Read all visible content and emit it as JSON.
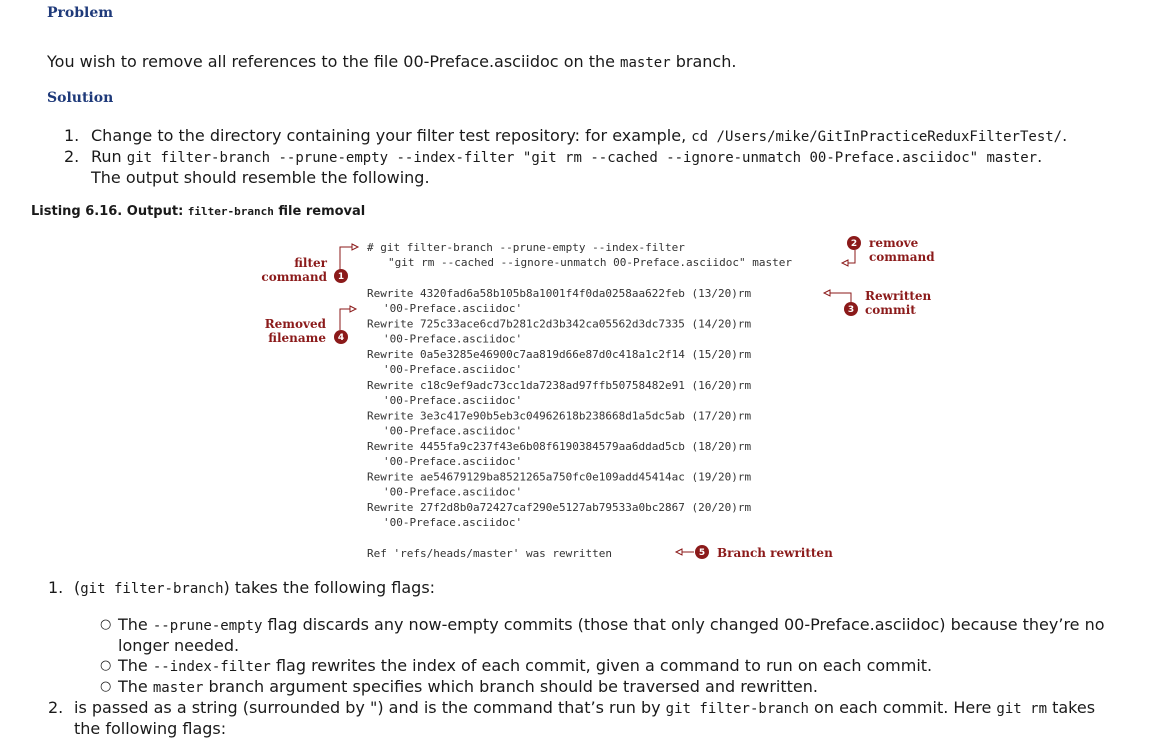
{
  "problem": {
    "heading": "Problem",
    "text_before": "You wish to remove all references to the file 00-Preface.asciidoc on the ",
    "branch_code": "master",
    "text_after": " branch."
  },
  "solution": {
    "heading": "Solution",
    "step1": {
      "num": "1.",
      "text": "Change to the directory containing your filter test repository: for example, ",
      "code": "cd /Users/mike/GitInPracticeReduxFilterTest/",
      "end": "."
    },
    "step2": {
      "num": "2.",
      "text": "Run ",
      "code": "git filter-branch --prune-empty --index-filter \"git rm --cached --ignore-unmatch 00-Preface.asciidoc\" master",
      "end": ".",
      "line2": "The output should resemble the following."
    }
  },
  "listing": {
    "caption_prefix": "Listing 6.16. Output: ",
    "caption_code": "filter-branch",
    "caption_suffix": " file removal",
    "command_line1": "# git filter-branch --prune-empty --index-filter",
    "command_line2": "\"git rm --cached --ignore-unmatch 00-Preface.asciidoc\" master",
    "rewrites": [
      {
        "line": "Rewrite 4320fad6a58b105b8a1001f4f0da0258aa622feb (13/20)rm",
        "file": "'00-Preface.asciidoc'"
      },
      {
        "line": "Rewrite 725c33ace6cd7b281c2d3b342ca05562d3dc7335 (14/20)rm",
        "file": "'00-Preface.asciidoc'"
      },
      {
        "line": "Rewrite 0a5e3285e46900c7aa819d66e87d0c418a1c2f14 (15/20)rm",
        "file": "'00-Preface.asciidoc'"
      },
      {
        "line": "Rewrite c18c9ef9adc73cc1da7238ad97ffb50758482e91 (16/20)rm",
        "file": "'00-Preface.asciidoc'"
      },
      {
        "line": "Rewrite 3e3c417e90b5eb3c04962618b238668d1a5dc5ab (17/20)rm",
        "file": "'00-Preface.asciidoc'"
      },
      {
        "line": "Rewrite 4455fa9c237f43e6b08f6190384579aa6ddad5cb (18/20)rm",
        "file": "'00-Preface.asciidoc'"
      },
      {
        "line": "Rewrite ae54679129ba8521265a750fc0e109add45414ac (19/20)rm",
        "file": "'00-Preface.asciidoc'"
      },
      {
        "line": "Rewrite 27f2d8b0a72427caf290e5127ab79533a0bc2867 (20/20)rm",
        "file": "'00-Preface.asciidoc'"
      }
    ],
    "ref_line": "Ref 'refs/heads/master' was rewritten",
    "annotations": {
      "filter_line1": "filter",
      "filter_line2": "command",
      "filter_num": "1",
      "remove_line1": "remove",
      "remove_line2": "command",
      "remove_num": "2",
      "rewritten_line1": "Rewritten",
      "rewritten_line2": "commit",
      "rewritten_num": "3",
      "removed_line1": "Removed",
      "removed_line2": "filename",
      "removed_num": "4",
      "branch_text": "Branch rewritten",
      "branch_num": "5"
    }
  },
  "notes": {
    "item1": {
      "num": "1.",
      "pre": "(",
      "code": "git filter-branch",
      "post": ") takes the following flags:"
    },
    "bullets": [
      {
        "pre": "The ",
        "code": "--prune-empty",
        "post": " flag discards any now-empty commits (those that only changed 00-Preface.asciidoc) because they’re no",
        "line2": "longer needed."
      },
      {
        "pre": "The ",
        "code": "--index-filter",
        "post": " flag rewrites the index of each commit, given a command to run on each commit."
      },
      {
        "pre": "The ",
        "code": "master",
        "post": " branch argument specifies which branch should be traversed and rewritten."
      }
    ],
    "item2": {
      "num": "2.",
      "pre": "is passed as a string (surrounded by \") and is the command that’s run by ",
      "code1": "git filter-branch",
      "mid": " on each commit. Here ",
      "code2": "git rm",
      "post": " takes",
      "line2": "the following flags:"
    }
  }
}
